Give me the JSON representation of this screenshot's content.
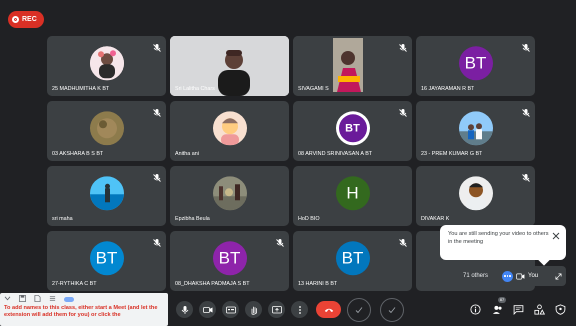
{
  "rec": {
    "label": "REC",
    "color": "#d93025"
  },
  "participants": [
    {
      "name": "25 MADHUMITHA K BT",
      "kind": "photo",
      "photo": "woman-with-flowers"
    },
    {
      "name": "Sri Lalitha Chars",
      "kind": "video",
      "photo": "man-in-black-shirt"
    },
    {
      "name": "SIVAGAMI S",
      "kind": "video",
      "photo": "woman-in-saree"
    },
    {
      "name": "16 JAYARAMAN R BT",
      "kind": "letter",
      "letters": "BT",
      "color": "#7b1fa2"
    },
    {
      "name": "03 AKSHARA B S BT",
      "kind": "photo",
      "photo": "blurred-object"
    },
    {
      "name": "Anitha ani",
      "kind": "photo",
      "photo": "baby"
    },
    {
      "name": "08 ARVIND SRINIVASAN A BT",
      "kind": "ring",
      "letters": "BT",
      "color": "#6a1b9a"
    },
    {
      "name": "23 - PREM KUMAR G BT",
      "kind": "photo",
      "photo": "group-outdoor"
    },
    {
      "name": "sri maha",
      "kind": "photo",
      "photo": "person-at-sea"
    },
    {
      "name": "Epzibha Beula",
      "kind": "photo",
      "photo": "street-scene"
    },
    {
      "name": "HoD BIO",
      "kind": "letter",
      "letters": "H",
      "color": "#33691e"
    },
    {
      "name": "DIVAKAR K",
      "kind": "photo",
      "photo": "man-portrait"
    },
    {
      "name": "27-RYTHIKA C BT",
      "kind": "letter",
      "letters": "BT",
      "color": "#0288d1"
    },
    {
      "name": "08_DHAKSHA PADMAJA S BT",
      "kind": "letter",
      "letters": "BT",
      "color": "#8e24aa"
    },
    {
      "name": "13 HARINI B BT",
      "kind": "letter",
      "letters": "BT",
      "color": "#0277bd"
    }
  ],
  "toast": {
    "message": "You are still sending your video to others in the meeting"
  },
  "self_view": {
    "label": "You"
  },
  "others": {
    "label": "71 others"
  },
  "toolbar": {
    "badge_count": "87",
    "hangup_color": "#ea4335"
  },
  "extension": {
    "message": "To add names to this class, either start a Meet (and let the extension will add them for you) or click the"
  }
}
